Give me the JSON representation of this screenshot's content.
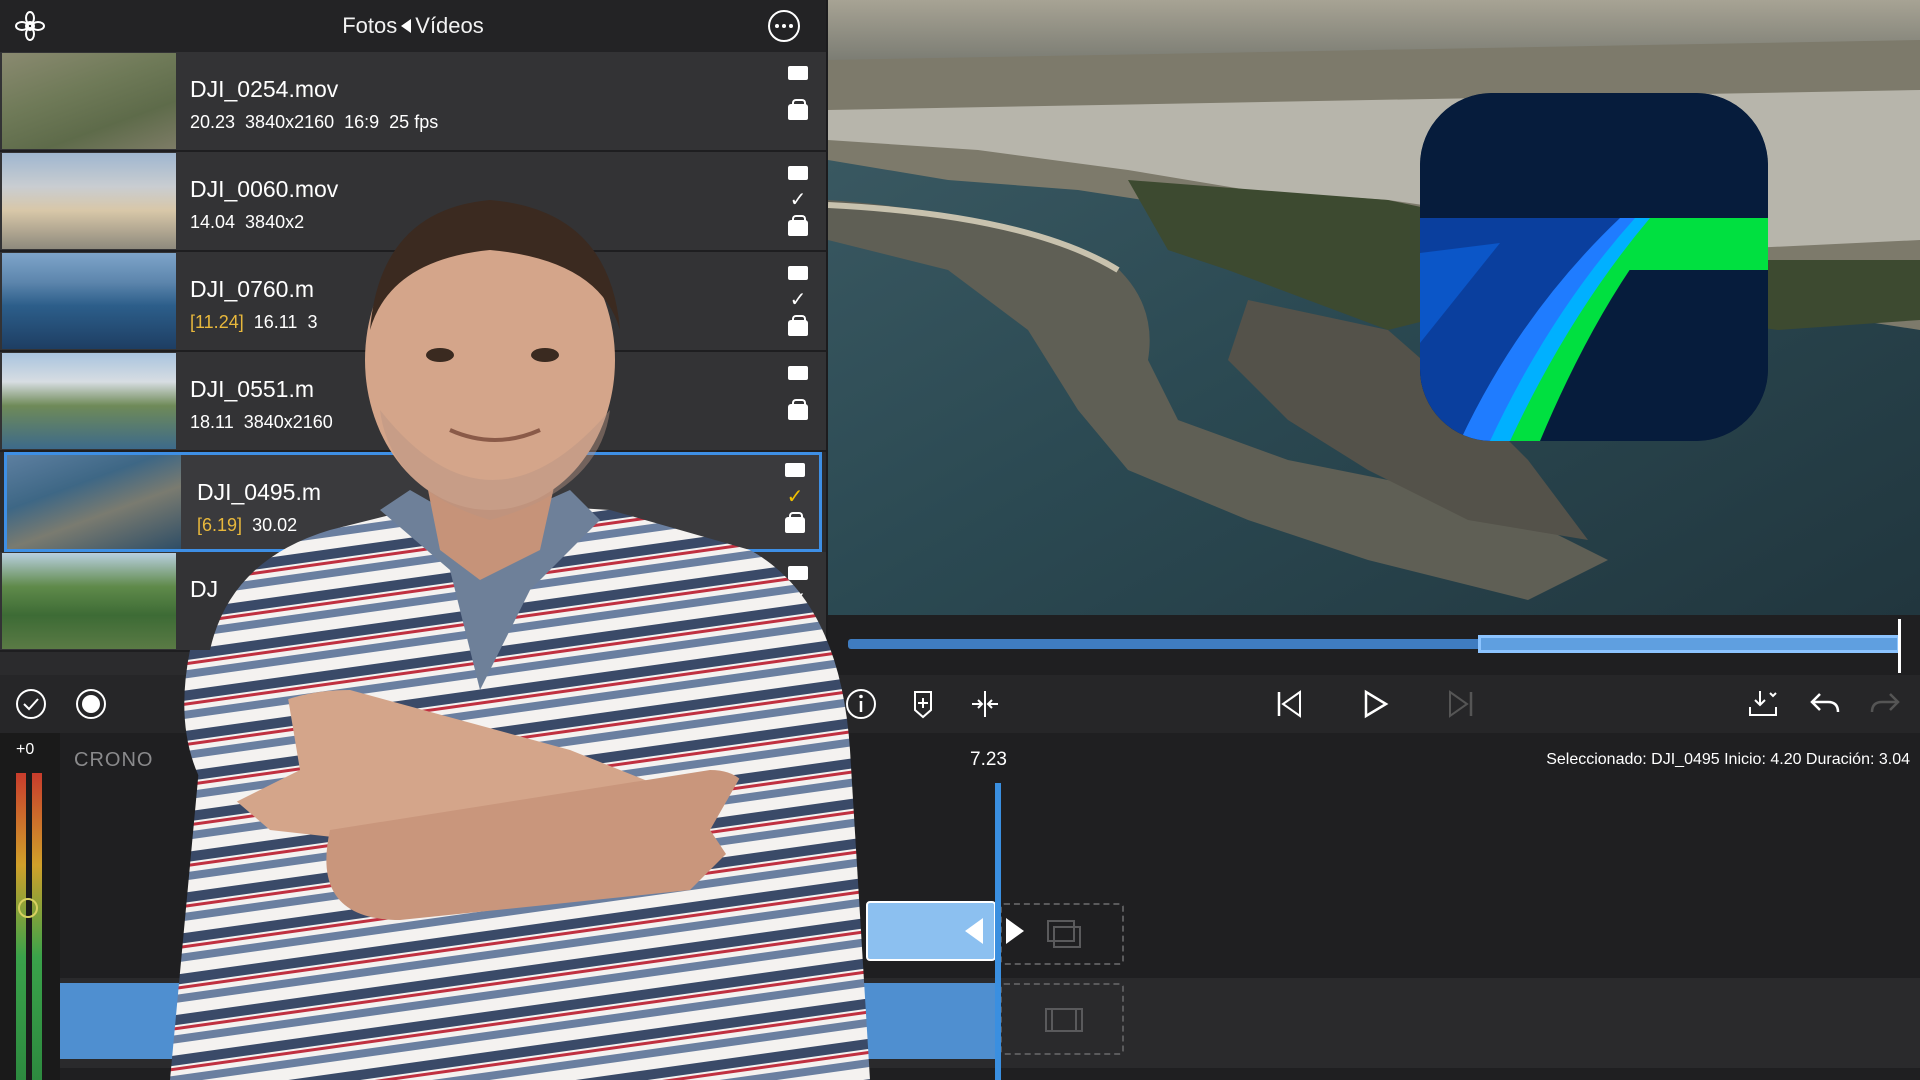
{
  "browser": {
    "title_left": "Fotos",
    "title_right": "Vídeos",
    "clips": [
      {
        "name": "DJI_0254.mov",
        "meta_tag": "",
        "meta": "20.23  3840x2160  16:9  25 fps",
        "checked": false
      },
      {
        "name": "DJI_0060.mov",
        "meta_tag": "",
        "meta": "14.04  3840x2",
        "checked": true
      },
      {
        "name": "DJI_0760.m",
        "meta_tag": "[11.24]",
        "meta": "16.11  3",
        "checked": true
      },
      {
        "name": "DJI_0551.m",
        "meta_tag": "",
        "meta": "18.11  3840x2160",
        "checked": false
      },
      {
        "name": "DJI_0495.m",
        "meta_tag": "[6.19]",
        "meta": "30.02",
        "checked": true,
        "selected": true
      },
      {
        "name": "DJ",
        "meta_tag": "",
        "meta": "",
        "checked": true
      }
    ]
  },
  "timeline": {
    "meter_label": "+0",
    "label": "CRONO",
    "time": "7.23",
    "selection_info": "Seleccionado: DJI_0495 Inicio: 4.20 Duración: 3.04"
  },
  "colors": {
    "accent": "#3e8fe5",
    "clip_blue": "#4f8fd0",
    "logo_bg": "#061c3c",
    "logo_green": "#00e040"
  },
  "icons": [
    "flower-icon",
    "more-icon",
    "check-circle-icon",
    "record-icon",
    "list-icon",
    "info-icon",
    "marker-icon",
    "split-icon",
    "skip-start-icon",
    "play-icon",
    "skip-end-icon",
    "export-icon",
    "undo-icon",
    "redo-icon"
  ]
}
